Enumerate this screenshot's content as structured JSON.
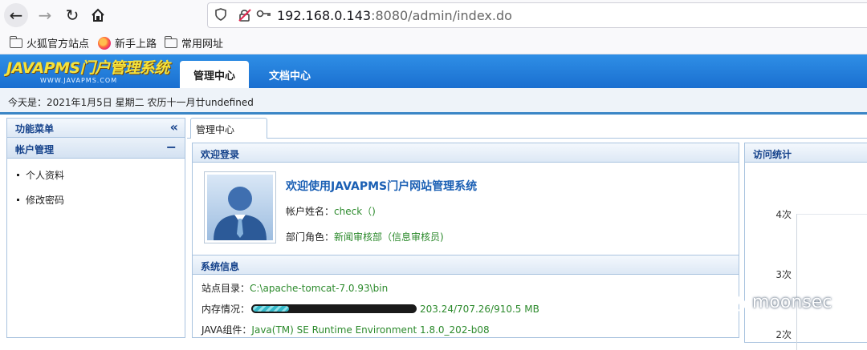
{
  "browser": {
    "url_host": "192.168.0.143",
    "url_rest": ":8080/admin/index.do",
    "bookmarks": [
      "火狐官方站点",
      "新手上路",
      "常用网址"
    ]
  },
  "app": {
    "logo_text": "JAVAPMS门户管理系统",
    "logo_sub": "WWW.JAVAPMS.COM",
    "tabs": [
      "管理中心",
      "文档中心"
    ],
    "date_text": "今天是：2021年1月5日 星期二 农历十一月廿undefined"
  },
  "sidebar": {
    "title": "功能菜单",
    "collapse_icon": "«",
    "section": "帐户管理",
    "section_icon": "−",
    "items": [
      "个人资料",
      "修改密码"
    ]
  },
  "center": {
    "tab_label": "管理中心",
    "welcome": {
      "header": "欢迎登录",
      "title": "欢迎使用JAVAPMS门户网站管理系统",
      "account_label": "帐户姓名：",
      "account_value": "check（)",
      "dept_label": "部门角色：",
      "dept_value": "新闻审核部（信息审核员)"
    },
    "sysinfo": {
      "header": "系统信息",
      "site_label": "站点目录：",
      "site_value": "C:\\apache-tomcat-7.0.93\\bin",
      "mem_label": "内存情况：",
      "mem_value": "203.24/707.26/910.5 MB",
      "mem_fill": 0.22,
      "java_label": "JAVA组件：",
      "java_value": "Java(TM) SE Runtime Environment 1.8.0_202-b08"
    }
  },
  "stats": {
    "header": "访问统计",
    "ticks": [
      "4次",
      "3次",
      "2次"
    ]
  },
  "watermark": "moonsec"
}
